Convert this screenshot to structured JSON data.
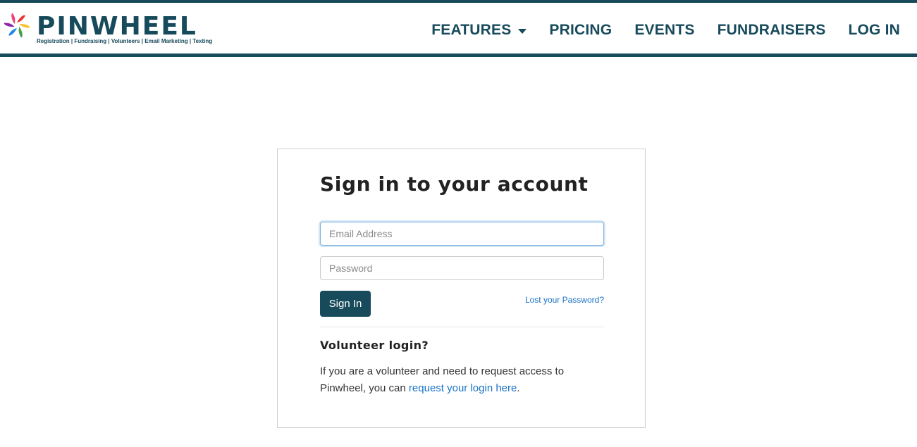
{
  "brand": {
    "name": "PINWHEEL",
    "tagline": "Registration | Fundraising | Volunteers | Email Marketing | Texting",
    "colors": {
      "primary": "#174a5b",
      "link": "#1a73c7",
      "petals": [
        "#e53935",
        "#fbc02d",
        "#43a047",
        "#1e88e5",
        "#8e24aa",
        "#ec407a"
      ]
    }
  },
  "nav": {
    "features": "FEATURES",
    "pricing": "PRICING",
    "events": "EVENTS",
    "fundraisers": "FUNDRAISERS",
    "login": "LOG IN",
    "features_icon": "caret-down-icon"
  },
  "login": {
    "title": "Sign in to your account",
    "email": {
      "placeholder": "Email Address",
      "value": ""
    },
    "password": {
      "placeholder": "Password",
      "value": ""
    },
    "signin_label": "Sign In",
    "lost_password": "Lost your Password?"
  },
  "volunteer": {
    "heading": "Volunteer login?",
    "text_before": "If you are a volunteer and need to request access to Pinwheel, you can ",
    "link_text": "request your login here",
    "text_after": "."
  }
}
